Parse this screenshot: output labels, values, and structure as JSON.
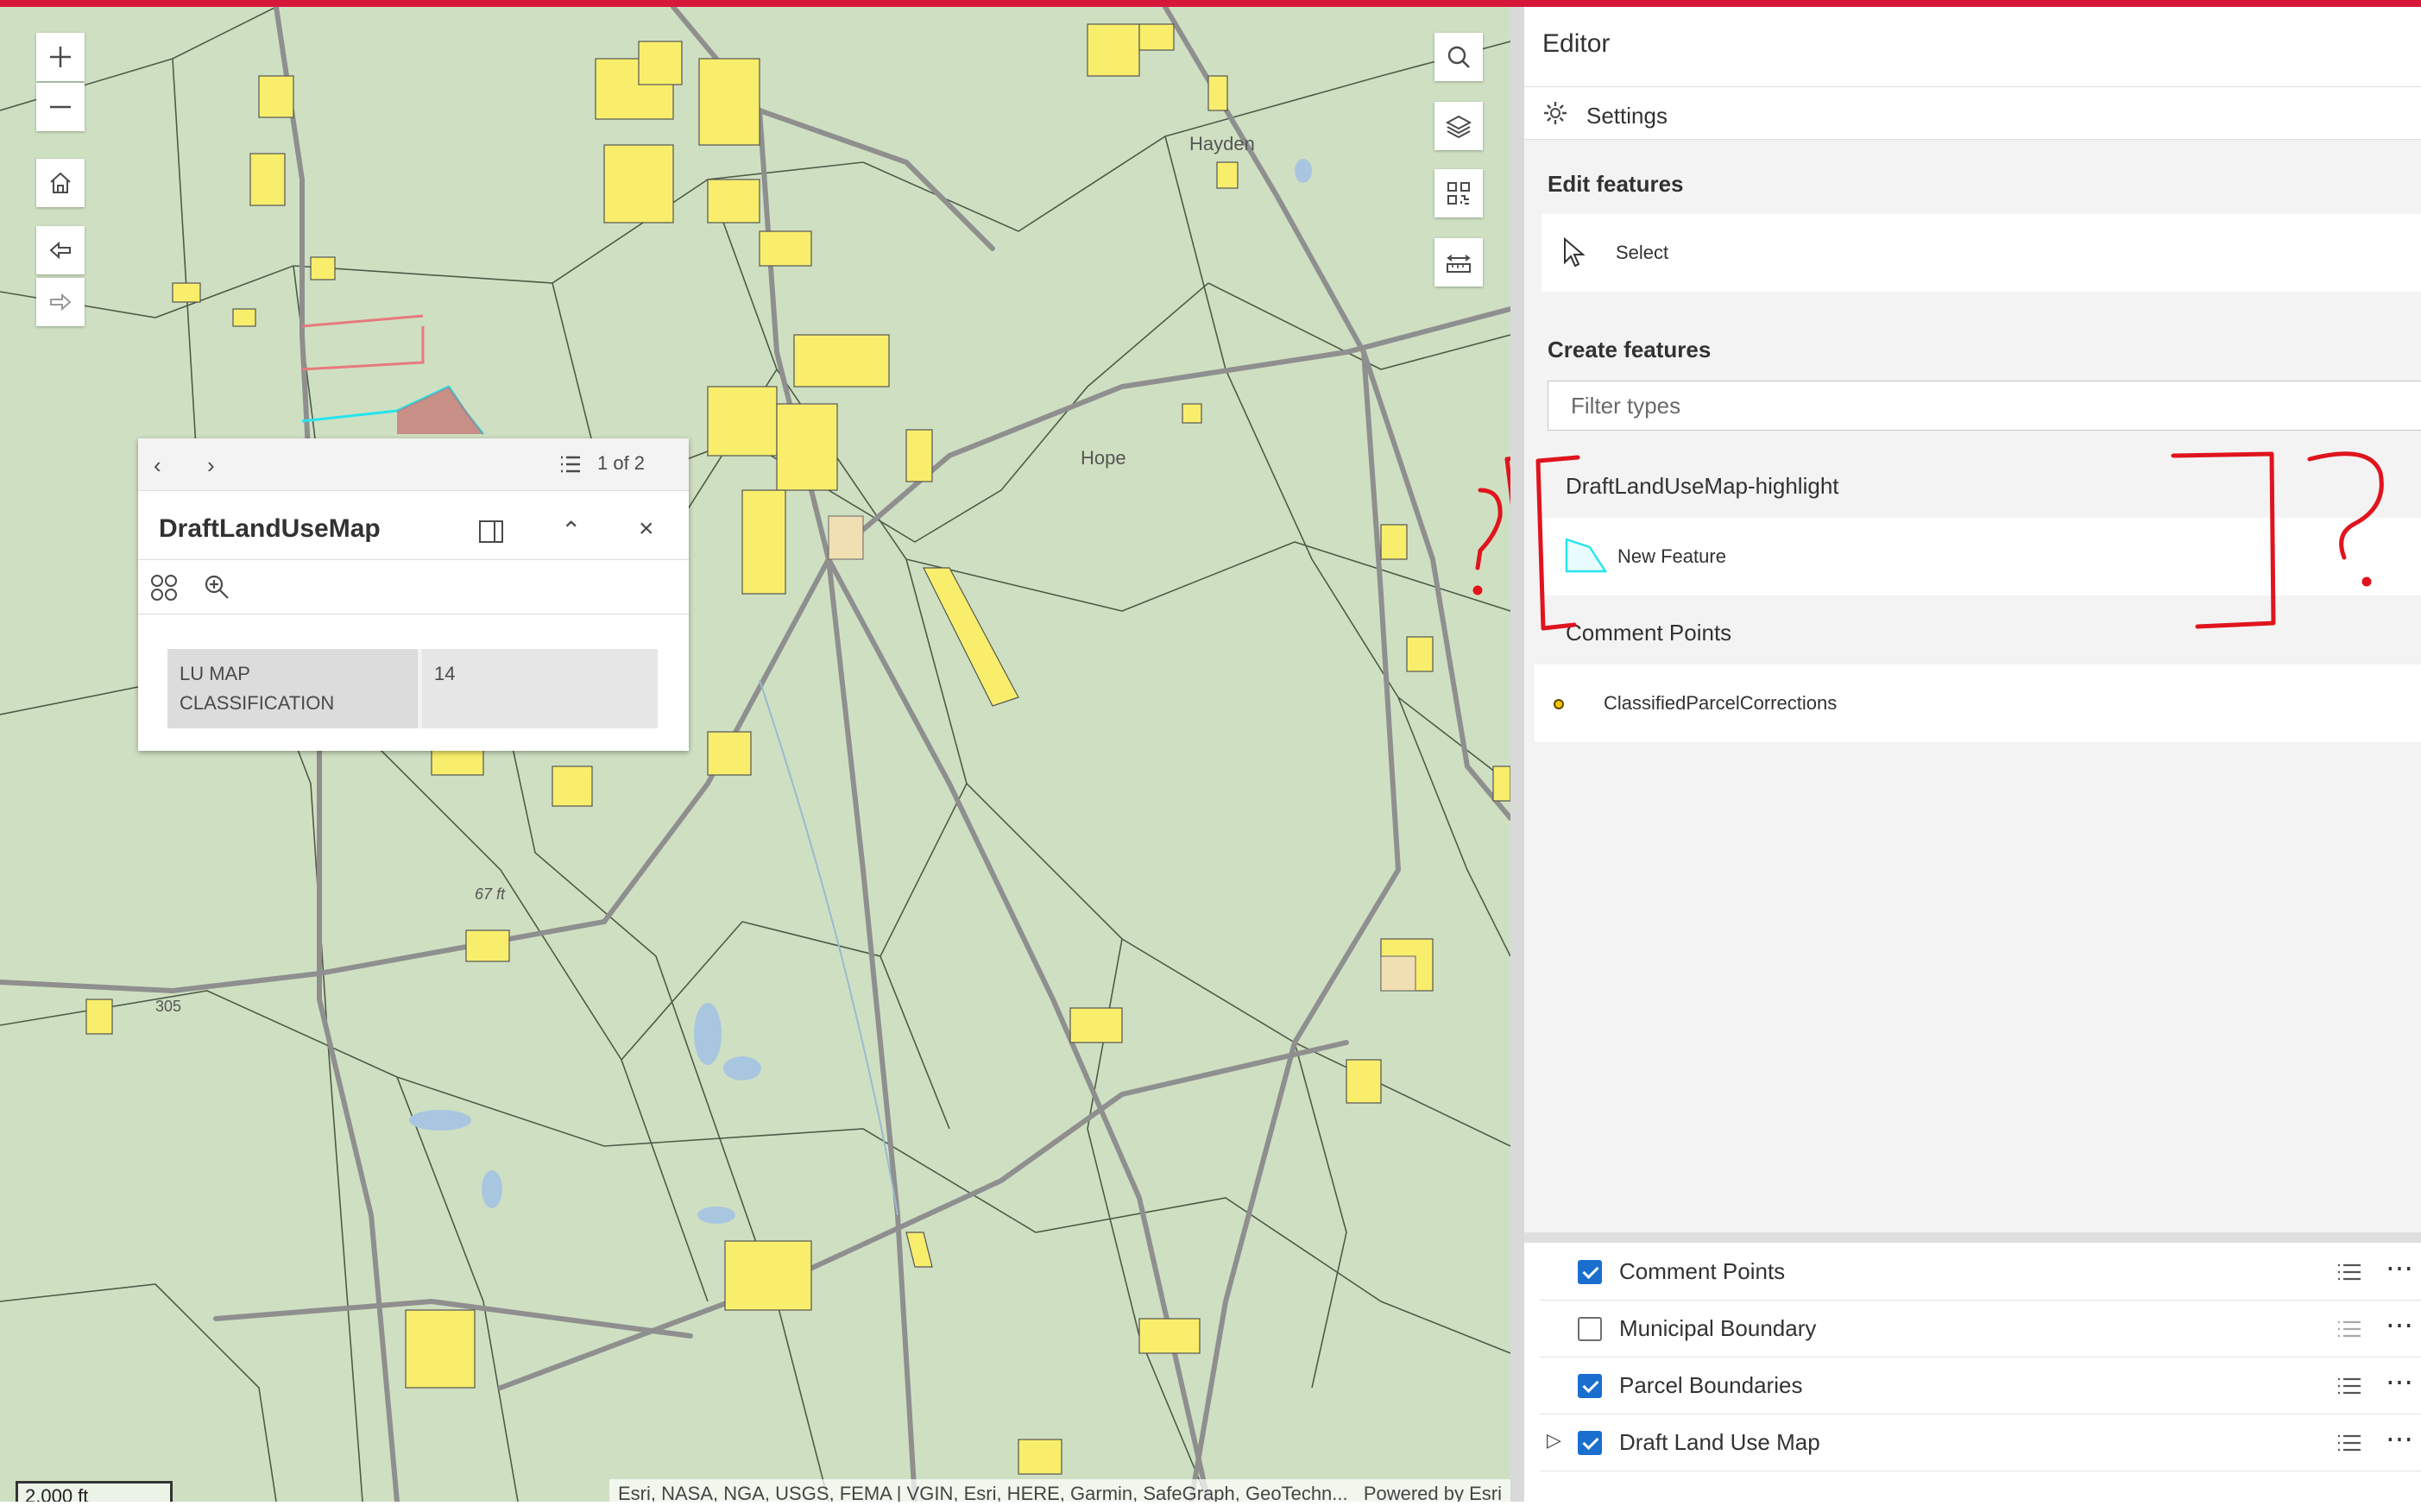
{
  "map": {
    "labels": {
      "hayden": "Hayden",
      "hope": "Hope",
      "route": "305",
      "elev": "67 ft"
    },
    "scale": "2,000 ft",
    "attribution": "Esri, NASA, NGA, USGS, FEMA | VGIN, Esri, HERE, Garmin, SafeGraph, GeoTechn...",
    "powered": "Powered by Esri",
    "colors": {
      "base": "#cfe0c2",
      "parcel": "#f8ee6b",
      "road": "#8f8f8f",
      "annotation": "#e0141e",
      "highlight": "#25e4ee"
    }
  },
  "popup": {
    "counter": "1 of 2",
    "title": "DraftLandUseMap",
    "fields": [
      {
        "key": "LU MAP CLASSIFICATION",
        "value": "14"
      }
    ]
  },
  "editor": {
    "title": "Editor",
    "settings_label": "Settings",
    "edit_features": "Edit features",
    "select_label": "Select",
    "create_features": "Create features",
    "filter_placeholder": "Filter types",
    "groups": [
      {
        "name": "DraftLandUseMap-highlight",
        "template": "New Feature"
      },
      {
        "name": "Comment Points",
        "template": "ClassifiedParcelCorrections"
      }
    ]
  },
  "layers": [
    {
      "name": "Comment Points",
      "checked": true
    },
    {
      "name": "Municipal Boundary",
      "checked": false
    },
    {
      "name": "Parcel Boundaries",
      "checked": true
    },
    {
      "name": "Draft Land Use Map",
      "checked": true
    }
  ]
}
